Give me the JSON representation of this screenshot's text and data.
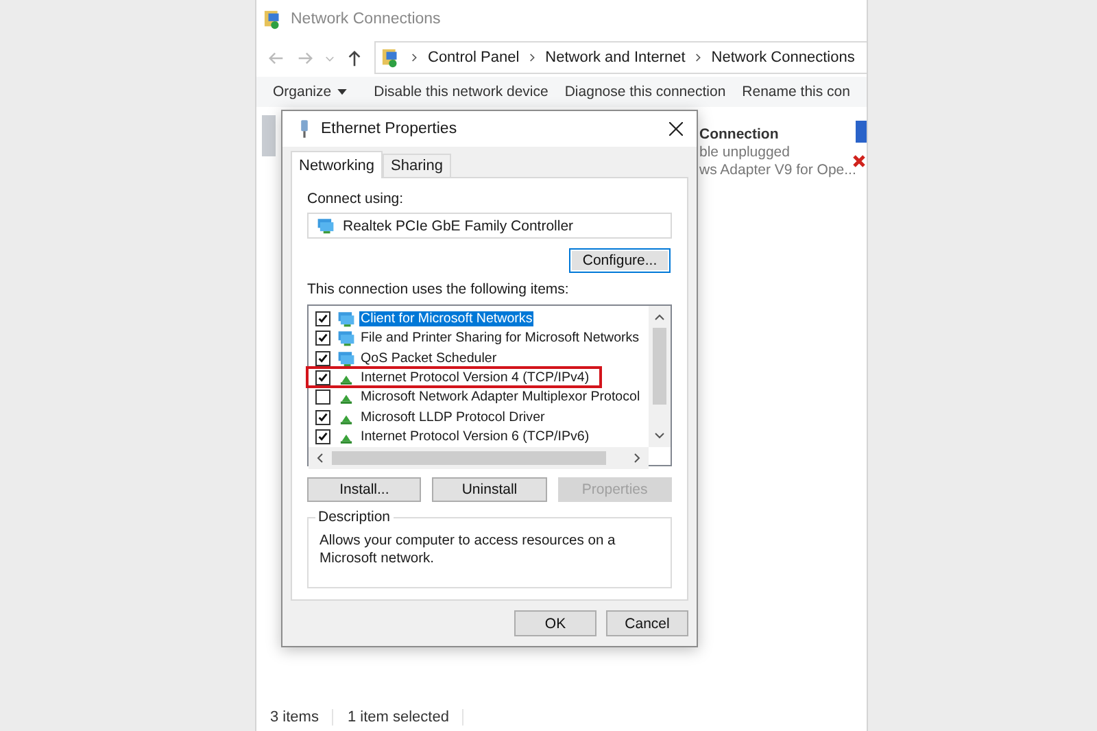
{
  "explorer": {
    "title": "Network Connections",
    "breadcrumbs": [
      "Control Panel",
      "Network and Internet",
      "Network Connections"
    ],
    "toolbar": [
      {
        "label": "Organize",
        "dropdown": true
      },
      {
        "label": "Disable this network device",
        "dropdown": false
      },
      {
        "label": "Diagnose this connection",
        "dropdown": false
      },
      {
        "label": "Rename this con",
        "dropdown": false
      }
    ],
    "connection": {
      "name": "Connection",
      "status": "ble unplugged",
      "device": "ws Adapter V9 for Ope..."
    },
    "status_bar": [
      "3 items",
      "1 item selected"
    ]
  },
  "dialog": {
    "title": "Ethernet Properties",
    "tabs": [
      {
        "label": "Networking",
        "selected": true
      },
      {
        "label": "Sharing",
        "selected": false
      }
    ],
    "connect_using_label": "Connect using:",
    "adapter": "Realtek PCIe GbE Family Controller",
    "configure_button": "Configure...",
    "items_label": "This connection uses the following items:",
    "items": [
      {
        "label": "Client for Microsoft Networks",
        "kind": "client",
        "checked": true,
        "selected": true,
        "highlighted": false
      },
      {
        "label": "File and Printer Sharing for Microsoft Networks",
        "kind": "client",
        "checked": true,
        "selected": false,
        "highlighted": false
      },
      {
        "label": "QoS Packet Scheduler",
        "kind": "client",
        "checked": true,
        "selected": false,
        "highlighted": false
      },
      {
        "label": "Internet Protocol Version 4 (TCP/IPv4)",
        "kind": "protocol",
        "checked": true,
        "selected": false,
        "highlighted": true
      },
      {
        "label": "Microsoft Network Adapter Multiplexor Protocol",
        "kind": "protocol",
        "checked": false,
        "selected": false,
        "highlighted": false
      },
      {
        "label": "Microsoft LLDP Protocol Driver",
        "kind": "protocol",
        "checked": true,
        "selected": false,
        "highlighted": false
      },
      {
        "label": "Internet Protocol Version 6 (TCP/IPv6)",
        "kind": "protocol",
        "checked": true,
        "selected": false,
        "highlighted": false
      }
    ],
    "buttons": [
      {
        "label": "Install...",
        "disabled": false
      },
      {
        "label": "Uninstall",
        "disabled": false
      },
      {
        "label": "Properties",
        "disabled": true
      }
    ],
    "description": {
      "title": "Description",
      "text": "Allows your computer to access resources on a Microsoft network."
    },
    "footer_buttons": [
      "OK",
      "Cancel"
    ]
  }
}
